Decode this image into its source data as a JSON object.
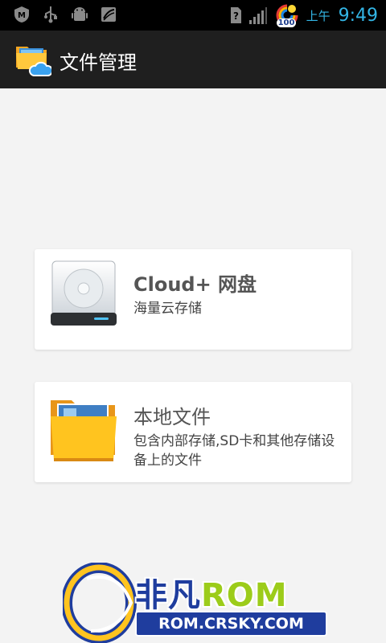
{
  "status_bar": {
    "left_icons": [
      "mcafee-icon",
      "usb-icon",
      "android-debug-icon",
      "sd-card-icon"
    ],
    "right_icons": [
      "sim-unknown-icon",
      "signal-icon",
      "weather-battery-icon"
    ],
    "battery_badge": "100",
    "ampm": "上午",
    "time": "9:49",
    "accent_color": "#33b5e5"
  },
  "action_bar": {
    "app_icon": "folder-cloud-icon",
    "title": "文件管理"
  },
  "cards": [
    {
      "icon": "hard-drive-icon",
      "title": "Cloud+ 网盘",
      "subtitle": "海量云存储"
    },
    {
      "icon": "folder-icon",
      "title": "本地文件",
      "subtitle": "包含内部存储,SD卡和其他存储设备上的文件"
    }
  ],
  "watermark": {
    "brand_prefix": "非凡",
    "brand_suffix": "ROM",
    "url": "ROM.CRSKY.COM"
  }
}
